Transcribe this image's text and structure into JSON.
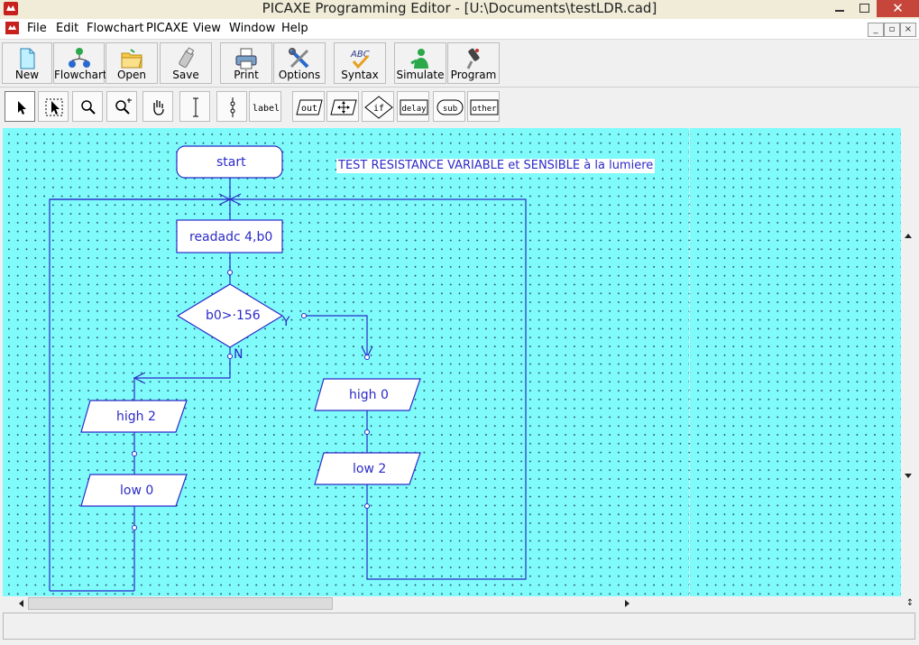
{
  "window": {
    "title": "PICAXE Programming Editor  - [U:\\Documents\\testLDR.cad]",
    "close_glyph": "✕"
  },
  "menu": {
    "items": [
      "File",
      "Edit",
      "Flowchart",
      "PICAXE",
      "View",
      "Window",
      "Help"
    ]
  },
  "toolbar": {
    "buttons": [
      {
        "label": "New",
        "icon": "new-file-icon"
      },
      {
        "label": "Flowchart",
        "icon": "flowchart-icon"
      },
      {
        "label": "Open",
        "icon": "open-folder-icon"
      },
      {
        "label": "Save",
        "icon": "save-usb-icon"
      },
      {
        "label": "Print",
        "icon": "printer-icon"
      },
      {
        "label": "Options",
        "icon": "tools-icon"
      },
      {
        "label": "Syntax",
        "icon": "syntax-check-icon"
      },
      {
        "label": "Simulate",
        "icon": "simulate-person-icon"
      },
      {
        "label": "Program",
        "icon": "program-cable-icon"
      }
    ]
  },
  "flow_toolbar": {
    "tools": [
      {
        "name": "select",
        "icon": "arrow-pointer-icon"
      },
      {
        "name": "area-select",
        "icon": "area-select-icon"
      },
      {
        "name": "zoom",
        "icon": "zoom-icon"
      },
      {
        "name": "zoom-area",
        "icon": "zoom-area-icon"
      },
      {
        "name": "pan",
        "icon": "hand-pan-icon"
      },
      {
        "name": "line",
        "icon": "line-tool-icon"
      },
      {
        "name": "connect",
        "icon": "connector-tool-icon"
      }
    ],
    "label_tool": "label",
    "shapes": [
      "out",
      "",
      "if",
      "delay",
      "sub",
      "other"
    ]
  },
  "flowchart": {
    "start_label": "start",
    "comment": "TEST RESISTANCE VARIABLE et SENSIBLE à la lumiere",
    "readadc": "readadc  4,b0",
    "decision": "b0>·156",
    "yes": "Y",
    "no": "N",
    "high2": "high 2",
    "low0": "low 0",
    "high0": "high 0",
    "low2": "low 2"
  },
  "colors": {
    "canvas": "#7ffbfb",
    "line": "#2b2bc8",
    "title_close": "#c7463b"
  }
}
